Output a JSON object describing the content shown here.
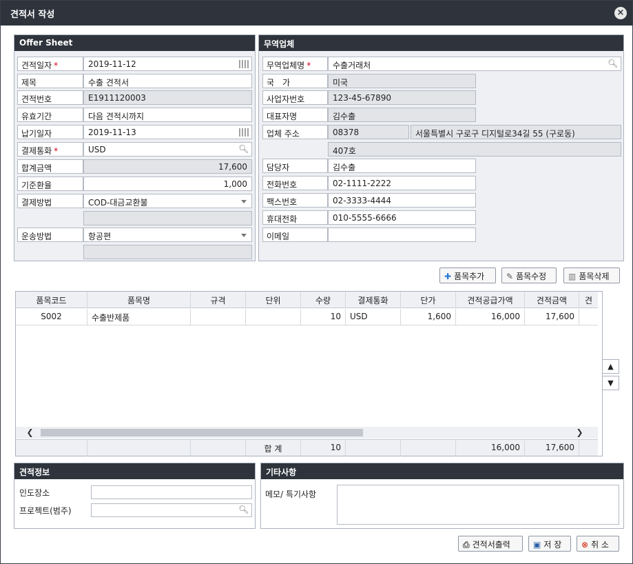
{
  "window": {
    "title": "견적서 작성",
    "close_icon": "×"
  },
  "offer": {
    "header": "Offer Sheet",
    "rows": [
      {
        "label": "견적일자",
        "required": true,
        "value": "2019-11-12",
        "readonly": false,
        "icon": "calendar-icon"
      },
      {
        "label": "제목",
        "required": false,
        "value": "수출 견적서",
        "readonly": false
      },
      {
        "label": "견적번호",
        "required": false,
        "value": "E1911120003",
        "readonly": true
      },
      {
        "label": "유효기간",
        "required": false,
        "value": "다음 견적시까지",
        "readonly": false
      },
      {
        "label": "납기일자",
        "required": false,
        "value": "2019-11-13",
        "readonly": false,
        "icon": "calendar-icon"
      },
      {
        "label": "결제통화",
        "required": true,
        "value": "USD",
        "readonly": false,
        "icon": "search-icon"
      },
      {
        "label": "합계금액",
        "required": false,
        "value": "17,600",
        "readonly": true,
        "numeric": true
      },
      {
        "label": "기준환율",
        "required": false,
        "value": "1,000",
        "readonly": false,
        "numeric": true
      },
      {
        "label": "결제방법",
        "required": false,
        "value": "COD-대금교환불",
        "readonly": false,
        "icon": "dropdown-icon"
      },
      {
        "label": "운송방법",
        "required": false,
        "value": "항공편",
        "readonly": false,
        "icon": "dropdown-icon"
      }
    ],
    "required_mark": "*"
  },
  "trade": {
    "header": "무역업체",
    "company_label": "무역업체명",
    "company_value": "수출거래처",
    "country_label": "국　가",
    "country_value": "미국",
    "bizno_label": "사업자번호",
    "bizno_value": "123-45-67890",
    "ceo_label": "대표자명",
    "ceo_value": "김수출",
    "addr_label": "업체 주소",
    "zip": "08378",
    "addr1": "서울특별시 구로구 디지털로34길 55 (구로동)",
    "addr2": "407호",
    "manager_label": "담당자",
    "manager_value": "김수출",
    "phone_label": "전화번호",
    "phone_value": "02-1111-2222",
    "fax_label": "팩스번호",
    "fax_value": "02-3333-4444",
    "mobile_label": "휴대전화",
    "mobile_value": "010-5555-6666",
    "email_label": "이메일",
    "email_value": ""
  },
  "item_buttons": {
    "add": "품목추가",
    "edit": "품목수정",
    "delete": "품목삭제"
  },
  "grid": {
    "columns": [
      "품목코드",
      "품목명",
      "규격",
      "단위",
      "수량",
      "결제통화",
      "단가",
      "견적공급가액",
      "견적금액",
      "견"
    ],
    "rows": [
      [
        "S002",
        "수출반제품",
        "",
        "",
        "10",
        "USD",
        "1,600",
        "16,000",
        "17,600",
        ""
      ]
    ],
    "footer": [
      "",
      "",
      "",
      "합 계",
      "10",
      "",
      "",
      "16,000",
      "17,600",
      ""
    ],
    "scroll_left": "❮",
    "scroll_right": "❯",
    "move_up": "▲",
    "move_down": "▼"
  },
  "quote_info": {
    "header": "견적정보",
    "place_label": "인도장소",
    "place_value": "",
    "project_label": "프로젝트(범주)",
    "project_value": ""
  },
  "etc": {
    "header": "기타사항",
    "memo_label": "메모/ 특기사항",
    "memo_value": ""
  },
  "footer_buttons": {
    "print": "견적서출력",
    "save": "저 장",
    "cancel": "취 소"
  },
  "colors": {
    "title_bar": "#2e333c",
    "panel_bg": "#eef0f4",
    "readonly_bg": "#e2e4e8",
    "required": "#d0021b",
    "add_icon": "#2a7ad6",
    "cancel_icon": "#d9412b"
  }
}
